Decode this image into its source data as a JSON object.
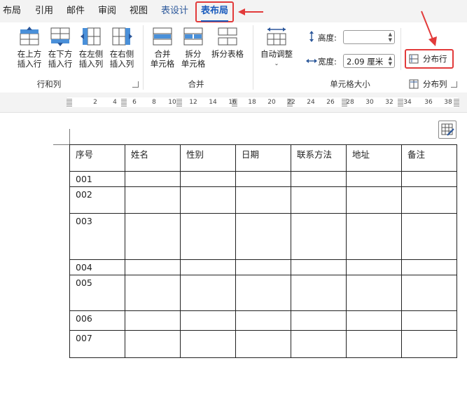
{
  "tabs": [
    {
      "label": "布局"
    },
    {
      "label": "引用"
    },
    {
      "label": "邮件"
    },
    {
      "label": "审阅"
    },
    {
      "label": "视图"
    },
    {
      "label": "表设计"
    },
    {
      "label": "表布局"
    }
  ],
  "ribbon": {
    "rows_cols": {
      "label": "行和列",
      "insert_above": "在上方\n插入行",
      "insert_below": "在下方\n插入行",
      "insert_left": "在左侧\n插入列",
      "insert_right": "在右侧\n插入列"
    },
    "merge": {
      "label": "合并",
      "merge_cells": "合并\n单元格",
      "split_cells": "拆分\n单元格",
      "split_table": "拆分表格"
    },
    "cell_size": {
      "label": "单元格大小",
      "autofit": "自动调整",
      "height_label": "高度:",
      "height_value": "",
      "width_label": "宽度:",
      "width_value": "2.09 厘米",
      "distribute_rows": "分布行",
      "distribute_cols": "分布列"
    }
  },
  "ruler": {
    "ticks": [
      "2",
      "4",
      "6",
      "8",
      "10",
      "12",
      "14",
      "16",
      "18",
      "20",
      "22",
      "24",
      "26",
      "28",
      "30",
      "32",
      "34",
      "36",
      "38"
    ]
  },
  "table": {
    "headers": [
      "序号",
      "姓名",
      "性别",
      "日期",
      "联系方法",
      "地址",
      "备注"
    ],
    "rows": [
      {
        "id": "001",
        "height": 22
      },
      {
        "id": "002",
        "height": 38
      },
      {
        "id": "003",
        "height": 66
      },
      {
        "id": "004",
        "height": 22
      },
      {
        "id": "005",
        "height": 51
      },
      {
        "id": "006",
        "height": 28
      },
      {
        "id": "007",
        "height": 39
      }
    ]
  }
}
